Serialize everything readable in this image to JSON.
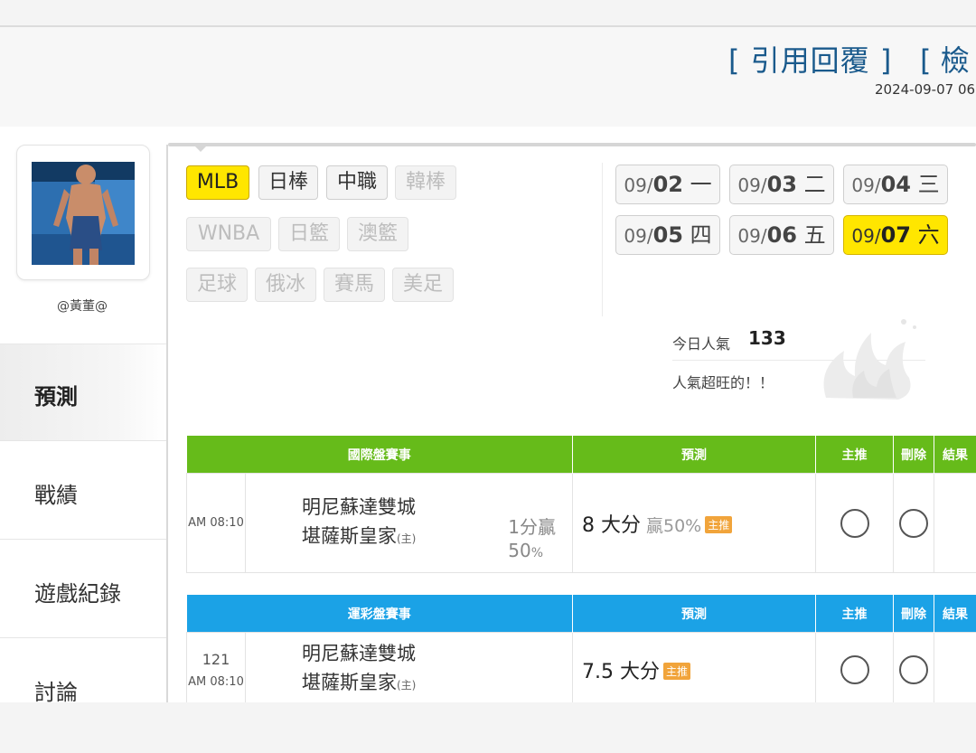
{
  "header": {
    "reply_link": "[ 引用回覆 ]",
    "check_link": "[ 檢",
    "post_time": "2024-09-07 06"
  },
  "user": {
    "name": "@黃董@"
  },
  "sidebar": {
    "items": [
      {
        "label": "預測"
      },
      {
        "label": "戰績"
      },
      {
        "label": "遊戲紀錄"
      },
      {
        "label": "討論"
      }
    ]
  },
  "leagues": [
    {
      "label": "MLB"
    },
    {
      "label": "日棒"
    },
    {
      "label": "中職"
    },
    {
      "label": "韓棒"
    },
    {
      "label": "WNBA"
    },
    {
      "label": "日籃"
    },
    {
      "label": "澳籃"
    },
    {
      "label": "足球"
    },
    {
      "label": "俄冰"
    },
    {
      "label": "賽馬"
    },
    {
      "label": "美足"
    }
  ],
  "dates": [
    {
      "md": "09/",
      "day": "02",
      "weekday": "一"
    },
    {
      "md": "09/",
      "day": "03",
      "weekday": "二"
    },
    {
      "md": "09/",
      "day": "04",
      "weekday": "三"
    },
    {
      "md": "09/",
      "day": "05",
      "weekday": "四"
    },
    {
      "md": "09/",
      "day": "06",
      "weekday": "五"
    },
    {
      "md": "09/",
      "day": "07",
      "weekday": "六"
    }
  ],
  "popularity": {
    "label": "今日人氣",
    "value": "133",
    "message": "人氣超旺的！！"
  },
  "international": {
    "headers": [
      "國際盤賽事",
      "預測",
      "主推",
      "刪除",
      "結果"
    ],
    "rows": [
      {
        "time": "AM 08:10",
        "away": "明尼蘇達雙城",
        "home": "堪薩斯皇家",
        "home_mark": "(主)",
        "spread_line1": "1分贏",
        "spread_pct": "50",
        "spread_pct_unit": "%",
        "prediction": "8 大分",
        "prediction_win": "贏50%",
        "badge": "主推"
      }
    ]
  },
  "sports_lottery": {
    "headers": [
      "運彩盤賽事",
      "預測",
      "主推",
      "刪除",
      "結果"
    ],
    "rows": [
      {
        "code": "121",
        "time": "AM 08:10",
        "away": "明尼蘇達雙城",
        "home": "堪薩斯皇家",
        "home_mark": "(主)",
        "prediction": "7.5 大分",
        "badge": "主推"
      }
    ]
  },
  "colors": {
    "accent_yellow": "#ffe600",
    "green_header": "#66bb1a",
    "blue_header": "#1ba2e6",
    "link_blue": "#1a5a8c",
    "badge_orange": "#f1a43b"
  }
}
